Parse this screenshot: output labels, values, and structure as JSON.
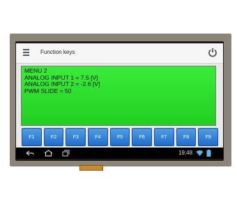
{
  "app": {
    "title": "Function keys"
  },
  "terminal": {
    "lines": [
      "MENU 2",
      "ANALOG INPUT 1 = 7.5 [V]",
      "ANALOG INPUT 2 = -2.6 [V]",
      "PWM SLIDE = 50"
    ]
  },
  "function_keys": [
    "F1",
    "F2",
    "F3",
    "F4",
    "F5",
    "F6",
    "F7",
    "F8",
    "F9"
  ],
  "status_bar": {
    "time": "19:48"
  },
  "colors": {
    "terminal_bg": "#2fe02f",
    "fkey_bg": "#2f82d8",
    "navbar_bg": "#000000"
  },
  "icons": {
    "menu": "hamburger-menu-icon",
    "power": "power-icon",
    "back": "back-icon",
    "home": "home-icon",
    "recents": "recents-icon",
    "wifi": "wifi-icon",
    "battery": "battery-icon"
  }
}
